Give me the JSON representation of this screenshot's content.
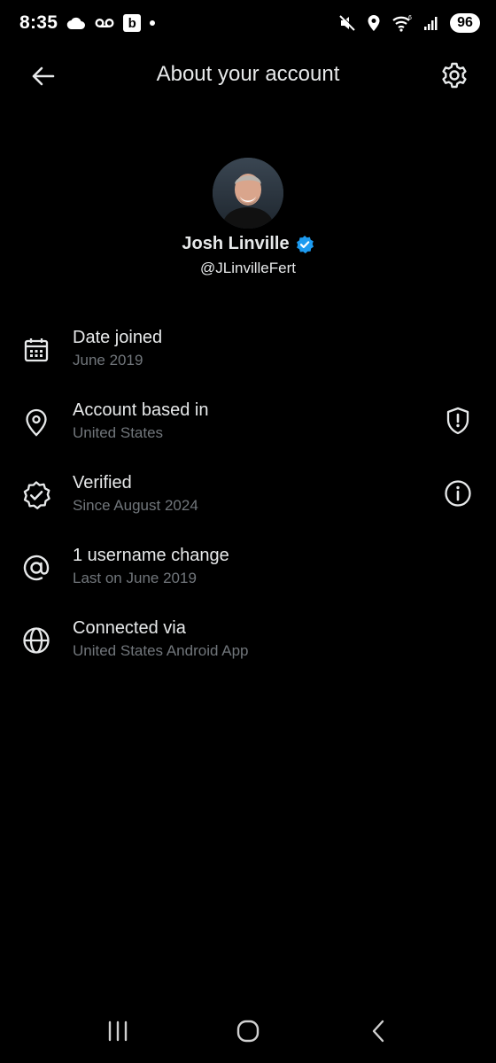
{
  "status_bar": {
    "time": "8:35",
    "b_label": "b",
    "battery": "96",
    "network_badge": "6"
  },
  "header": {
    "title": "About your account"
  },
  "profile": {
    "name": "Josh Linville",
    "handle": "@JLinvilleFert",
    "verified_color": "#1d9bf0"
  },
  "info_items": [
    {
      "icon": "calendar-icon",
      "title": "Date joined",
      "subtitle": "June 2019"
    },
    {
      "icon": "location-pin-icon",
      "title": "Account based in",
      "subtitle": "United States",
      "action_icon": "shield-icon"
    },
    {
      "icon": "verified-badge-icon",
      "title": "Verified",
      "subtitle": "Since August 2024",
      "action_icon": "info-icon"
    },
    {
      "icon": "at-sign-icon",
      "title": "1 username change",
      "subtitle": "Last on June 2019"
    },
    {
      "icon": "globe-icon",
      "title": "Connected via",
      "subtitle": "United States Android App"
    }
  ],
  "colors": {
    "background": "#000000",
    "text_primary": "#e7e9ea",
    "text_secondary": "#71767b",
    "accent": "#1d9bf0"
  }
}
